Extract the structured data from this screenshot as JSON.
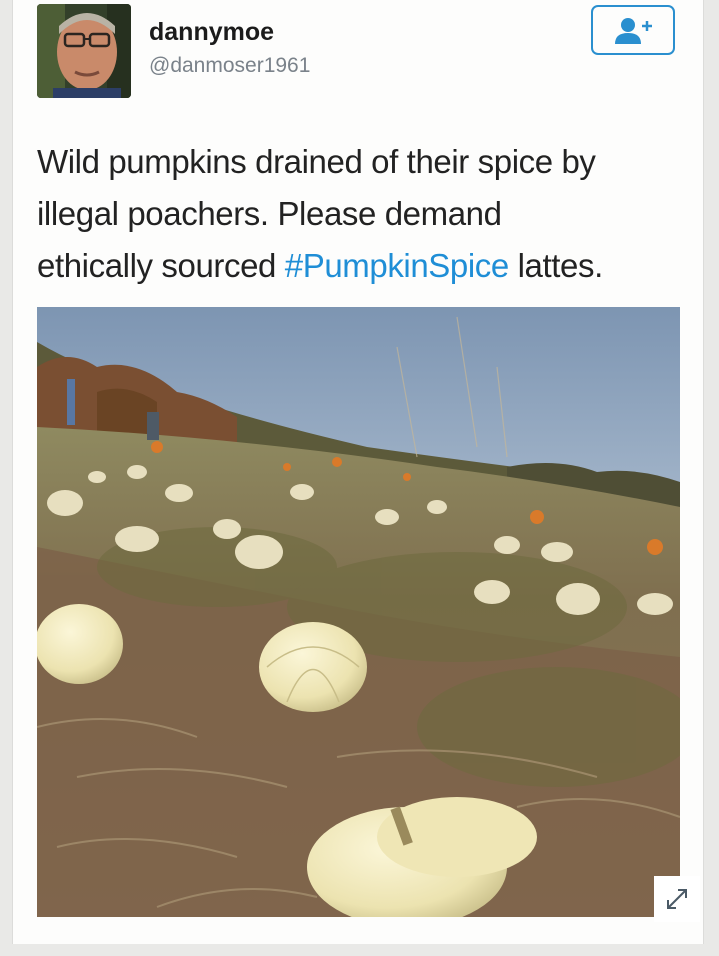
{
  "user": {
    "display_name": "dannymoe",
    "handle": "@danmoser1961"
  },
  "follow_button": {
    "icon": "add-user-icon",
    "color": "#2a8fcf"
  },
  "tweet": {
    "text_line1": "Wild pumpkins drained of their spice by",
    "text_line2": "illegal poachers. Please demand",
    "text_line3_before": "ethically sourced ",
    "hashtag": "#PumpkinSpice",
    "text_line3_after": " lattes.",
    "hashtag_color": "#1f8ed6"
  },
  "media": {
    "description_icon": "photo-white-pumpkin-field",
    "expand_icon": "expand-arrows-icon"
  }
}
